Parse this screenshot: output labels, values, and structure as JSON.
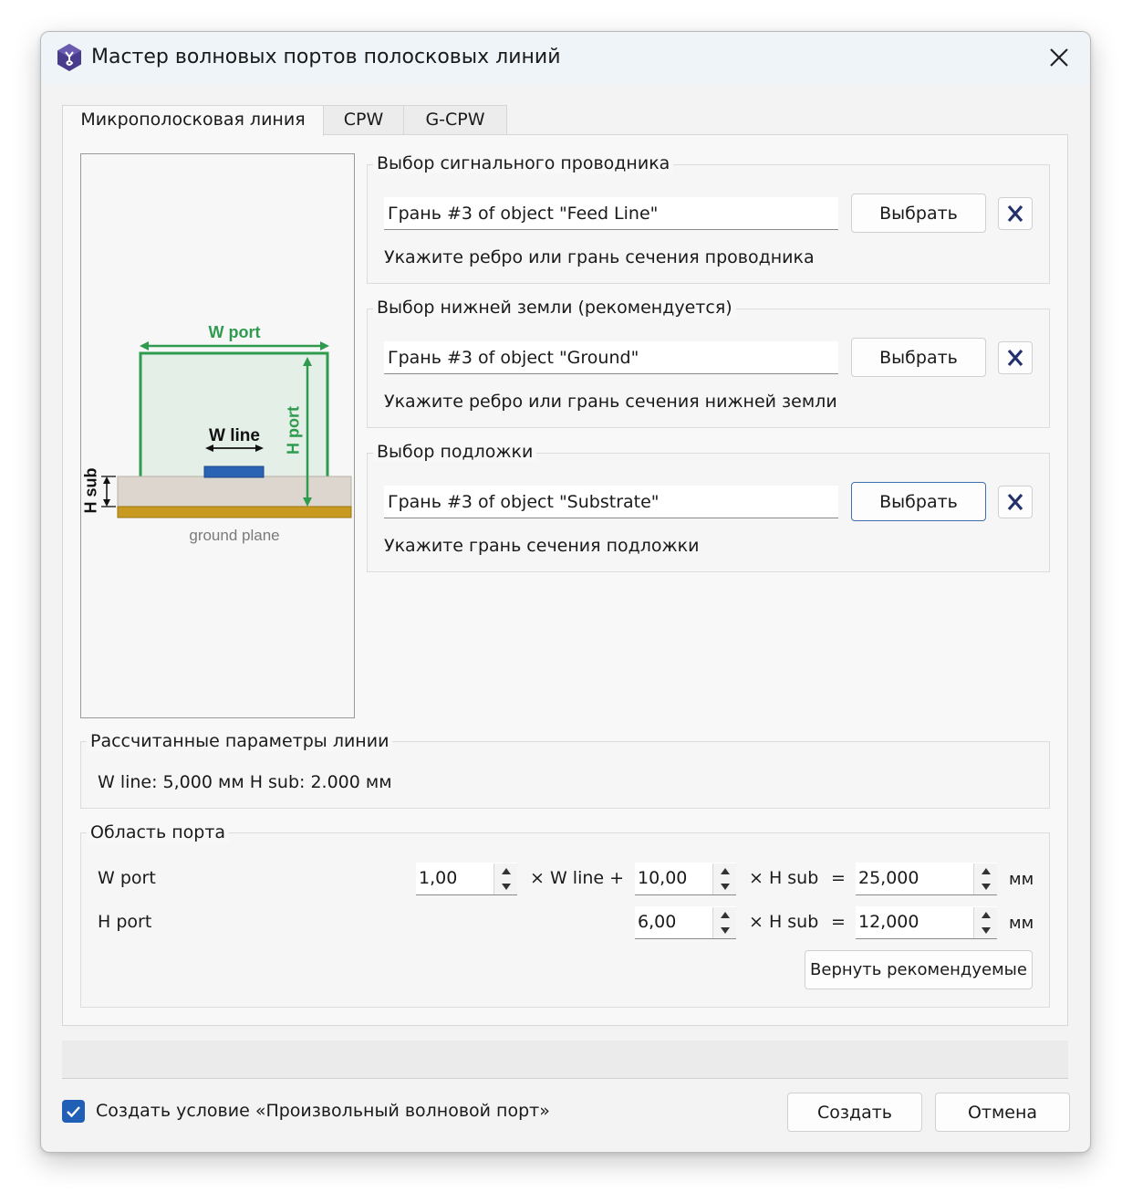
{
  "window": {
    "title": "Мастер волновых портов полосковых линий"
  },
  "tabs": [
    {
      "label": "Микрополосковая линия",
      "active": true
    },
    {
      "label": "CPW",
      "active": false
    },
    {
      "label": "G-CPW",
      "active": false
    }
  ],
  "diagram": {
    "w_port": "W port",
    "h_port": "H port",
    "w_line": "W line",
    "h_sub": "H sub",
    "ground_plane": "ground plane",
    "colors": {
      "port": "#2e9b4f",
      "line": "#2b63b4",
      "substrate": "#dcd6ce",
      "ground": "#c99a20"
    }
  },
  "signal": {
    "title": "Выбор сигнального проводника",
    "value": "Грань #3 of object \"Feed Line\"",
    "button": "Выбрать",
    "hint": "Укажите ребро или грань сечения проводника"
  },
  "ground": {
    "title": "Выбор нижней земли (рекомендуется)",
    "value": "Грань #3 of object \"Ground\"",
    "button": "Выбрать",
    "hint": "Укажите ребро или грань сечения нижней земли"
  },
  "substrate": {
    "title": "Выбор подложки",
    "value": "Грань #3 of object \"Substrate\"",
    "button": "Выбрать",
    "hint": "Укажите грань сечения подложки"
  },
  "calculated": {
    "title": "Рассчитанные параметры линии",
    "text": "W line:  5,000 мм   H sub:  2.000 мм"
  },
  "port_area": {
    "title": "Область порта",
    "w_port_label": "W port",
    "h_port_label": "H port",
    "w_factor_line": "1,00",
    "times_w_line": "× W line +",
    "w_factor_sub": "10,00",
    "times_h_sub": "× H sub",
    "equals": "=",
    "w_result": "25,000",
    "unit": "мм",
    "h_factor_sub": "6,00",
    "h_result": "12,000",
    "reset_button": "Вернуть рекомендуемые"
  },
  "footer": {
    "checkbox_label": "Создать условие «Произвольный волновой порт»",
    "checkbox_checked": true,
    "create_button": "Создать",
    "cancel_button": "Отмена"
  }
}
